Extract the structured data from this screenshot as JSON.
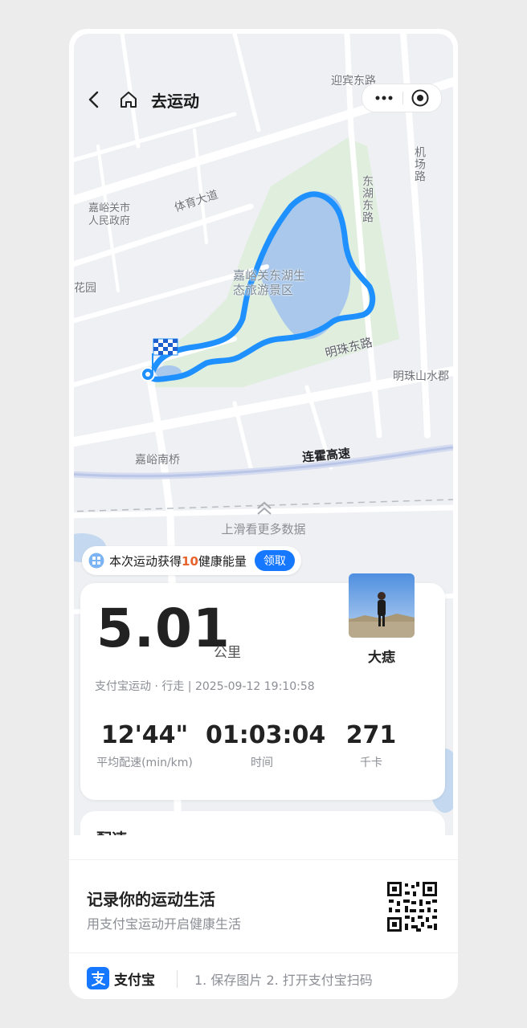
{
  "header": {
    "title": "去运动"
  },
  "map": {
    "labels": {
      "yingbin_road": "迎宾东路",
      "jichang_road": "机场路",
      "donghu_road": "东湖东路",
      "tiyu_road": "体育大道",
      "govt": "嘉峪关市\n人民政府",
      "scenic": "嘉峪关东湖生\n态旅游景区",
      "garden": "花园",
      "mingzhu_road": "明珠东路",
      "mingzhu_water": "明珠山水郡",
      "south_bridge": "嘉峪南桥",
      "expressway": "连霍高速"
    },
    "route_color": "#1e90ff"
  },
  "swipe_hint": "上滑看更多数据",
  "energy_banner": {
    "prefix": "本次运动获得",
    "amount": "10",
    "suffix": "健康能量",
    "button": "领取"
  },
  "summary": {
    "distance": "5.01",
    "distance_unit": "公里",
    "meta": "支付宝运动 · 行走 | 2025-09-12 19:10:58",
    "username": "大痣",
    "stats": [
      {
        "value": "12'44\"",
        "label": "平均配速(min/km)"
      },
      {
        "value": "01:03:04",
        "label": "时间"
      },
      {
        "value": "271",
        "label": "千卡"
      }
    ]
  },
  "next_section_title": "配速",
  "footer": {
    "title": "记录你的运动生活",
    "subtitle": "用支付宝运动开启健康生活",
    "brand": "支付宝",
    "steps": "1. 保存图片   2. 打开支付宝扫码"
  }
}
